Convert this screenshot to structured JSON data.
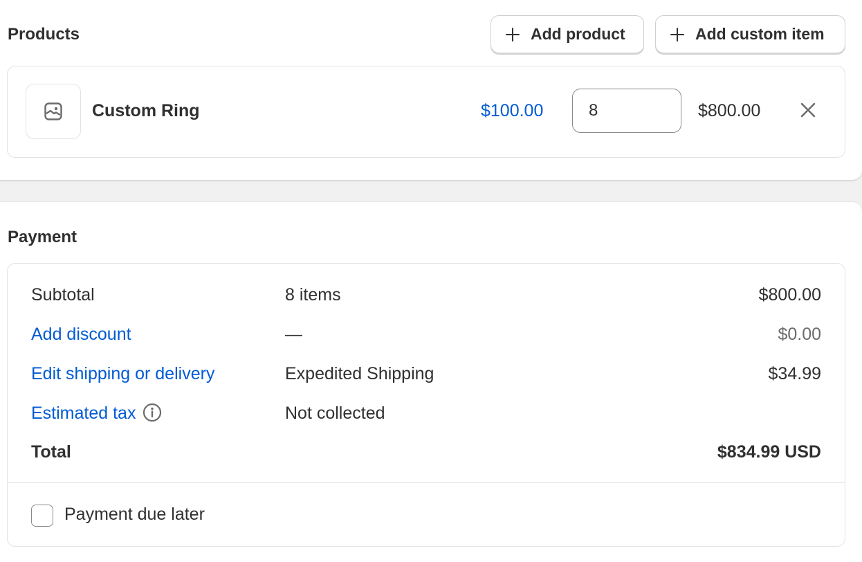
{
  "products": {
    "title": "Products",
    "add_product_label": "Add product",
    "add_custom_item_label": "Add custom item",
    "line_item": {
      "name": "Custom Ring",
      "unit_price": "$100.00",
      "quantity": "8",
      "line_total": "$800.00"
    }
  },
  "payment": {
    "title": "Payment",
    "rows": [
      {
        "label": "Subtotal",
        "detail": "8 items",
        "amount": "$800.00"
      },
      {
        "label": "Add discount",
        "detail": "—",
        "amount": "$0.00"
      },
      {
        "label": "Edit shipping or delivery",
        "detail": "Expedited Shipping",
        "amount": "$34.99"
      },
      {
        "label": "Estimated tax",
        "detail": "Not collected",
        "amount": ""
      },
      {
        "label": "Total",
        "detail": "",
        "amount": "$834.99 USD"
      }
    ],
    "payment_due_later_label": "Payment due later",
    "payment_due_later_checked": false
  },
  "colors": {
    "link": "#005bd3",
    "text": "#303030",
    "border": "#e3e3e3",
    "background": "#f1f1f1"
  },
  "icons": [
    "plus-icon",
    "image-placeholder-icon",
    "close-icon",
    "info-icon"
  ]
}
